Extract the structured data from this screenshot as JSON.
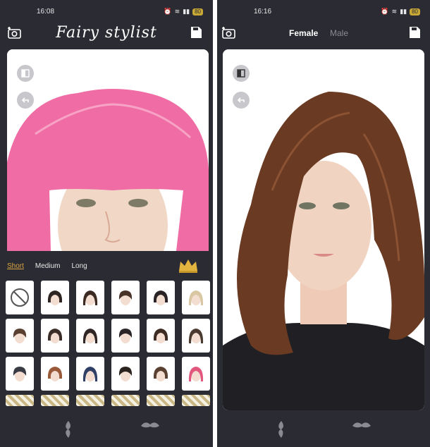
{
  "left": {
    "status": {
      "time": "16:08",
      "battery": "80"
    },
    "header": {
      "title": "Fairy stylist",
      "camera_icon": "camera-plus-icon",
      "save_icon": "save-icon"
    },
    "tabs": [
      {
        "label": "Short",
        "active": true
      },
      {
        "label": "Medium",
        "active": false
      },
      {
        "label": "Long",
        "active": false
      }
    ],
    "premium_icon": "crown-icon",
    "hairstyles": {
      "none_icon": "no-style-icon",
      "hair_colors": [
        "#2e2421",
        "#3a2a22",
        "#4a3328",
        "#2a2326",
        "#d8c7a2",
        "#5a4030",
        "#3b2d28",
        "#2f2625",
        "#2a2628",
        "#3d2b24",
        "#4a3a30",
        "#3a3c45",
        "#9a5a3a",
        "#2f3f66",
        "#2b2320",
        "#5a4030",
        "#e2577e"
      ]
    },
    "nav": {
      "styles_icon": "flame-icon",
      "makeup_icon": "mustache-icon"
    },
    "hair_color": "#f06ca4"
  },
  "right": {
    "status": {
      "time": "16:16",
      "battery": "80"
    },
    "header": {
      "camera_icon": "camera-plus-icon",
      "save_icon": "save-icon",
      "female_label": "Female",
      "male_label": "Male"
    },
    "nav": {
      "styles_icon": "flame-icon",
      "makeup_icon": "mustache-icon"
    },
    "hair_color": "#6a3a22"
  },
  "accent": "#d9a441"
}
